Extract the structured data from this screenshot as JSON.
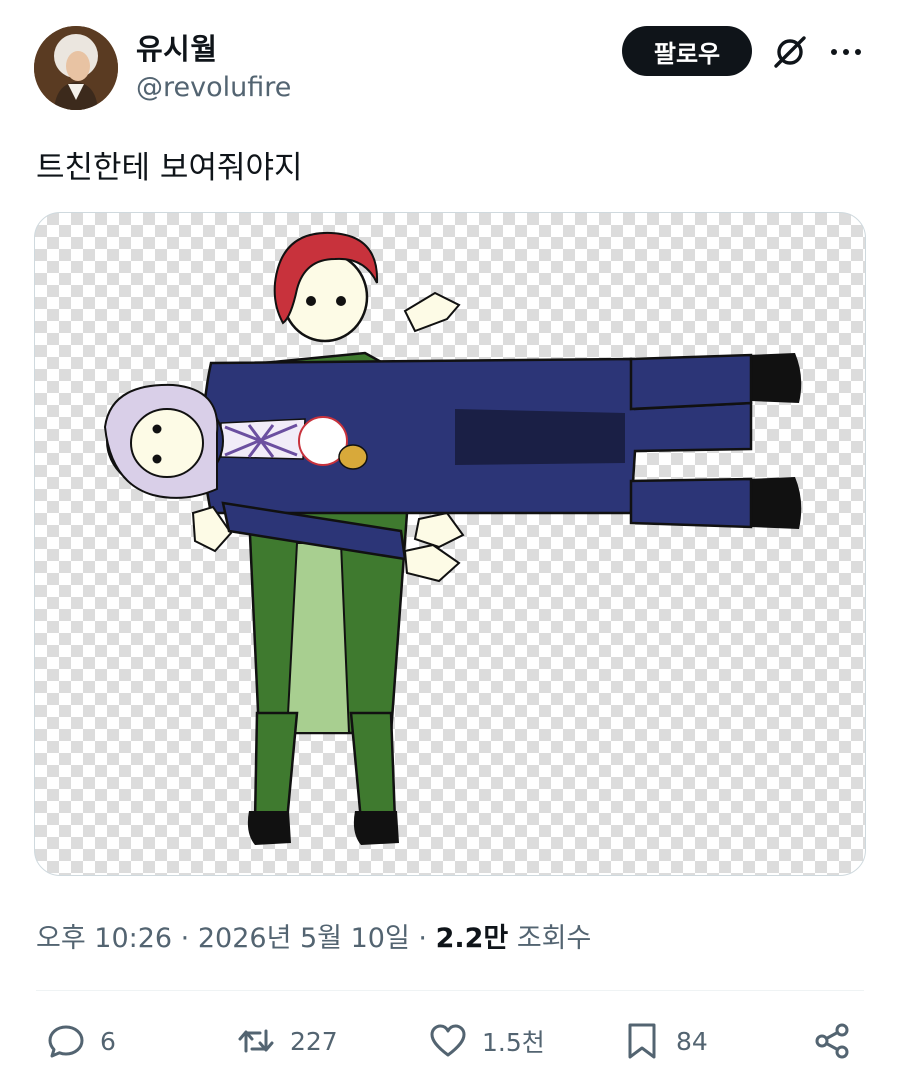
{
  "header": {
    "display_name": "유시월",
    "handle": "@revolufire",
    "follow_label": "팔로우"
  },
  "tweet": {
    "text": "트친한테 보여줘야지"
  },
  "meta": {
    "time": "오후 10:26",
    "separator": "·",
    "date": "2026년 5월 10일",
    "views_count": "2.2만",
    "views_label": "조회수"
  },
  "actions": {
    "replies": "6",
    "retweets": "227",
    "likes": "1.5천",
    "bookmarks": "84"
  },
  "icons": {
    "grok": "grok-icon",
    "more": "more-icon",
    "reply": "reply-icon",
    "retweet": "retweet-icon",
    "like": "heart-icon",
    "bookmark": "bookmark-icon",
    "share": "share-icon"
  },
  "colors": {
    "text_primary": "#0f1419",
    "text_secondary": "#536471",
    "follow_bg": "#0f1419",
    "border": "#cfd9de"
  }
}
